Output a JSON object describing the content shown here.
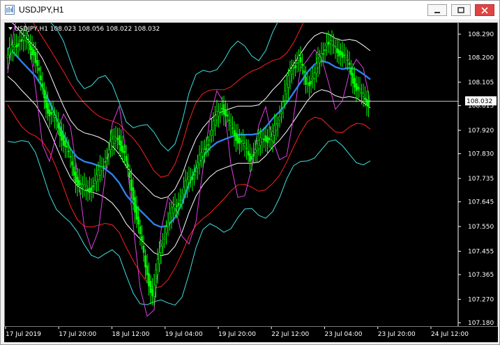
{
  "window": {
    "title": "USDJPY,H1",
    "buttons": {
      "minimize": "minimize",
      "maximize": "maximize",
      "close": "close"
    }
  },
  "chart": {
    "header": "USDJPY,H1  108.023 108.056 108.022 108.032",
    "current_price_label": "108.032",
    "price_ticks": [
      "108.290",
      "108.200",
      "108.105",
      "108.015",
      "107.920",
      "107.830",
      "107.735",
      "107.645",
      "107.550",
      "107.455",
      "107.365",
      "107.270",
      "107.180"
    ],
    "time_ticks": [
      "17 Jul 2019",
      "17 Jul 20:00",
      "18 Jul 12:00",
      "19 Jul 04:00",
      "19 Jul 20:00",
      "22 Jul 12:00",
      "23 Jul 04:00",
      "23 Jul 20:00",
      "24 Jul 12:00"
    ],
    "colors": {
      "background": "#000000",
      "candles": "#00ff00",
      "moving_average": "#2f80ed",
      "envelope_white": "#ffffff",
      "envelope_red": "#ff2020",
      "envelope_cyan": "#40e0e0",
      "oscillator_magenta": "#e040e0"
    }
  },
  "chart_data": {
    "type": "line",
    "title": "USDJPY,H1",
    "ylim": [
      107.18,
      108.29
    ],
    "series": [
      {
        "values": [
          108.2,
          108.24,
          108.27,
          108.26,
          108.22,
          108.1,
          108.0,
          107.96,
          107.9,
          107.82,
          107.74,
          107.69,
          107.7,
          107.73,
          107.8,
          107.86,
          107.9,
          107.82,
          107.7,
          107.55,
          107.4,
          107.28,
          107.45,
          107.55,
          107.62,
          107.66,
          107.72,
          107.76,
          107.82,
          107.88,
          107.96,
          108.02,
          107.94,
          107.9,
          107.86,
          107.82,
          107.85,
          107.9,
          107.88,
          107.96,
          108.06,
          108.16,
          108.2,
          108.1,
          108.12,
          108.2,
          108.26,
          108.24,
          108.22,
          108.18,
          108.1,
          108.05,
          108.03
        ]
      }
    ]
  }
}
